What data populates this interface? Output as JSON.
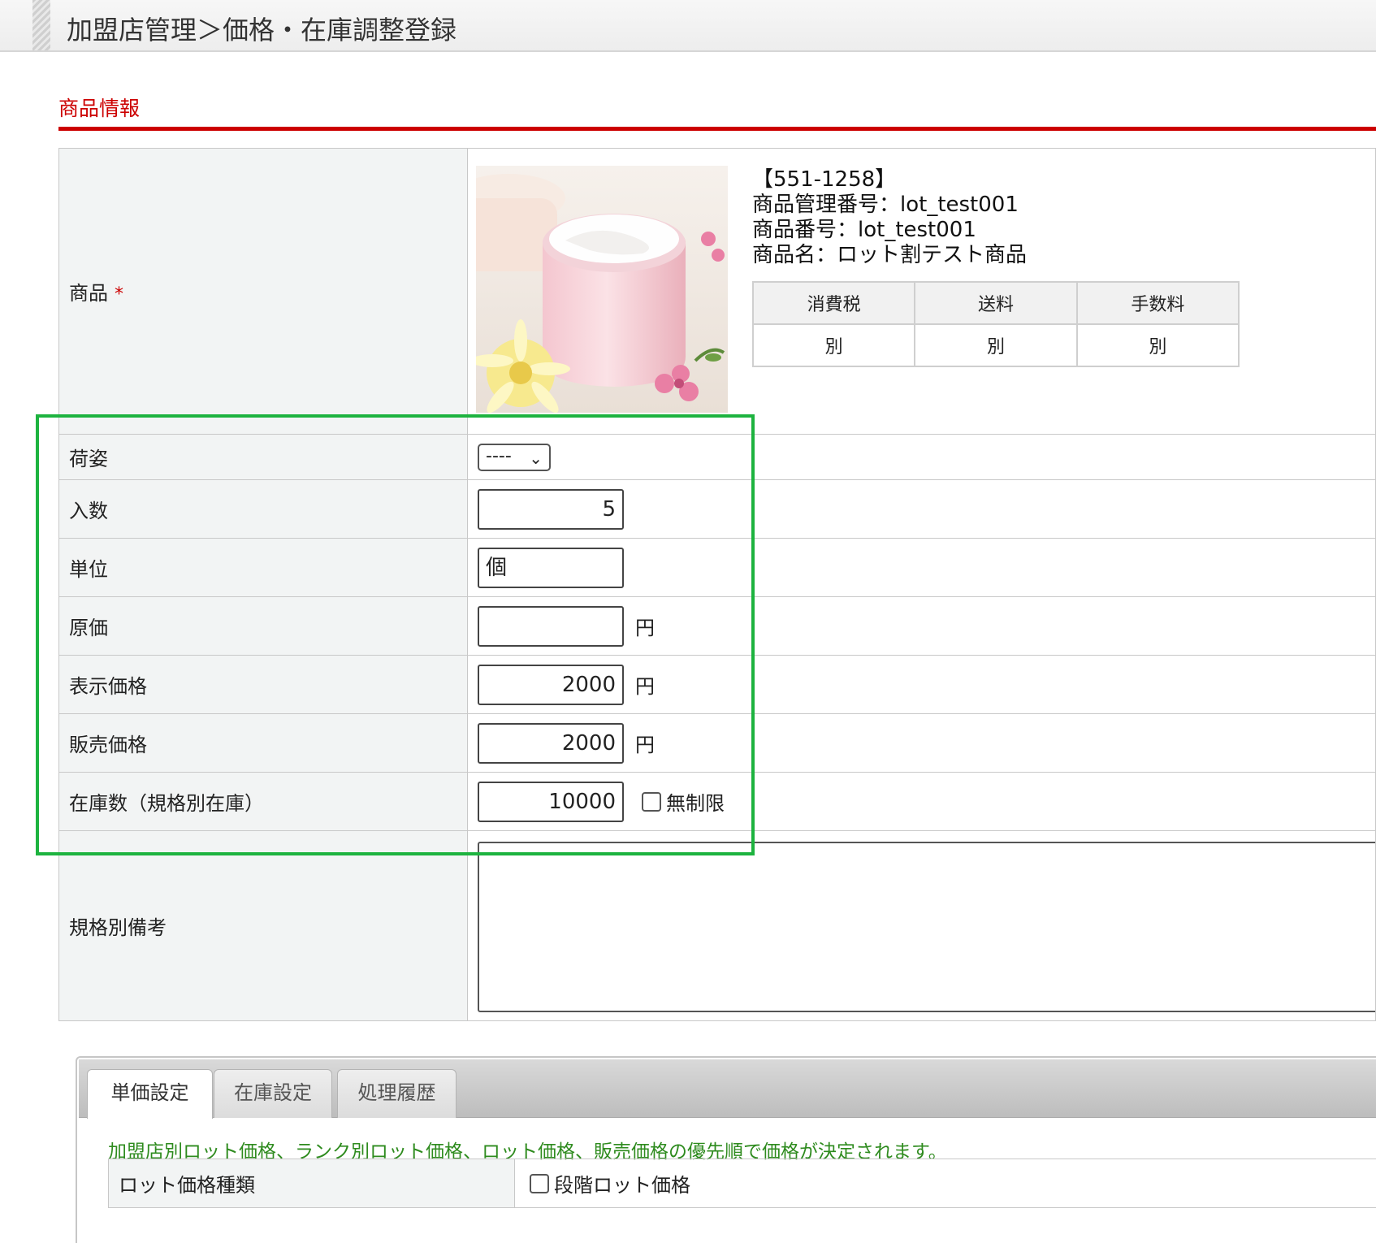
{
  "page": {
    "title": "加盟店管理＞価格・在庫調整登録"
  },
  "section": {
    "title": "商品情報"
  },
  "product": {
    "label": "商品",
    "required_mark": "*",
    "code": "【551-1258】",
    "management_number": "商品管理番号：lot_test001",
    "product_number": "商品番号：lot_test001",
    "product_name": "商品名：ロット割テスト商品",
    "tax_table": {
      "headers": [
        "消費税",
        "送料",
        "手数料"
      ],
      "values": [
        "別",
        "別",
        "別"
      ]
    }
  },
  "fields": {
    "packaging": {
      "label": "荷姿",
      "selected": "----"
    },
    "quantity": {
      "label": "入数",
      "value": "5"
    },
    "unit": {
      "label": "単位",
      "value": "個"
    },
    "cost": {
      "label": "原価",
      "value": "",
      "unit": "円"
    },
    "display_price": {
      "label": "表示価格",
      "value": "2000",
      "unit": "円"
    },
    "sale_price": {
      "label": "販売価格",
      "value": "2000",
      "unit": "円"
    },
    "stock": {
      "label": "在庫数（規格別在庫）",
      "value": "10000",
      "unlimited_label": "無制限",
      "unlimited_checked": false
    },
    "remarks": {
      "label": "規格別備考",
      "value": ""
    }
  },
  "tabs": {
    "items": [
      {
        "label": "単価設定",
        "active": true
      },
      {
        "label": "在庫設定",
        "active": false
      },
      {
        "label": "処理履歴",
        "active": false
      }
    ],
    "notice": "加盟店別ロット価格、ランク別ロット価格、ロット価格、販売価格の優先順で価格が決定されます。",
    "lot_price_type": {
      "label": "ロット価格種類",
      "option_label": "段階ロット価格",
      "checked": false
    }
  },
  "colors": {
    "accent_red": "#cc0000",
    "highlight_green": "#1db33f",
    "notice_green": "#2e8b1e",
    "label_bg": "#f2f4f4"
  }
}
